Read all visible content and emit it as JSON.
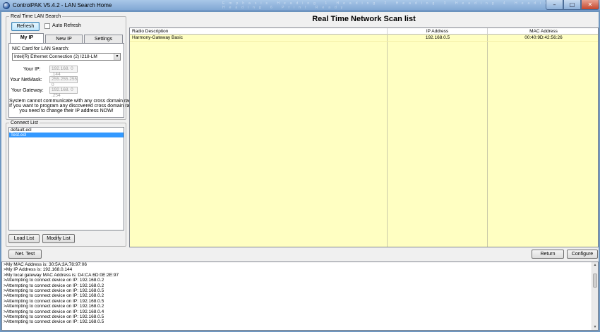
{
  "window": {
    "title": "ControlPAK V5.4.2 - LAN Search Home",
    "ghost_tabs": "Emphasis Heading 1 Heading 2 Heading 3 Heading 4 Heading 5 Heading 6 Print Ready",
    "minimize": "–",
    "maximize": "□",
    "close": "✕"
  },
  "lan_search": {
    "group_title": "Real Time LAN Search",
    "refresh_label": "Refresh",
    "auto_refresh_label": "Auto Refresh",
    "auto_refresh_checked": false
  },
  "tabs": {
    "items": [
      "My IP",
      "New IP",
      "Settings"
    ],
    "active": "My IP"
  },
  "my_ip": {
    "nic_label": "NIC Card for LAN Search:",
    "nic_value": "Intel(R) Ethernet Connection (2) I218-LM",
    "your_ip_label": "Your IP:",
    "your_ip_value": "192.168. 0 .144",
    "netmask_label": "Your NetMask:",
    "netmask_value": "255.255.255. 0",
    "gateway_label": "Your Gateway:",
    "gateway_value": "192.168. 0 .254",
    "warning_line1": "System cannot communicate with any cross domain radio.",
    "warning_line2": "If you want to program any discovered cross domain radio,",
    "warning_line3": "you need to change their IP address NOW!"
  },
  "connect_list": {
    "group_title": "Connect List",
    "items": [
      "default.ecl",
      "Test.ecl"
    ],
    "selected_index": 1,
    "load_label": "Load List",
    "modify_label": "Modify List"
  },
  "scan": {
    "title": "Real Time Network Scan list",
    "columns": [
      "Radio Description",
      "IP Address",
      "MAC Address"
    ],
    "rows": [
      [
        "Harmony-Gateway Basic",
        "192.168.0.5",
        "00:40:9D:42:56:26"
      ]
    ]
  },
  "actions": {
    "net_test_label": "Net. Test",
    "return_label": "Return",
    "configure_label": "Configure"
  },
  "log": {
    "lines": [
      ">My MAC Address is: 30:5A:3A:78:97:06",
      ">My IP Address is: 192.168.0.144",
      ">My local gateway MAC Address is: D4:CA:6D:0E:2E:97",
      ">Attempting to connect device on IP: 192.168.0.2",
      ">Attempting to connect device on IP: 192.168.0.2",
      ">Attempting to connect device on IP: 192.168.0.5",
      ">Attempting to connect device on IP: 192.168.0.2",
      ">Attempting to connect device on IP: 192.168.0.5",
      ">Attempting to connect device on IP: 192.168.0.2",
      ">Attempting to connect device on IP: 192.168.0.4",
      ">Attempting to connect device on IP: 192.168.0.5",
      ">Attempting to connect device on IP: 192.168.0.5"
    ]
  },
  "colors": {
    "grid_background": "#ffffc2",
    "selection": "#3399ff",
    "window_frame": "#7fa6d3"
  }
}
